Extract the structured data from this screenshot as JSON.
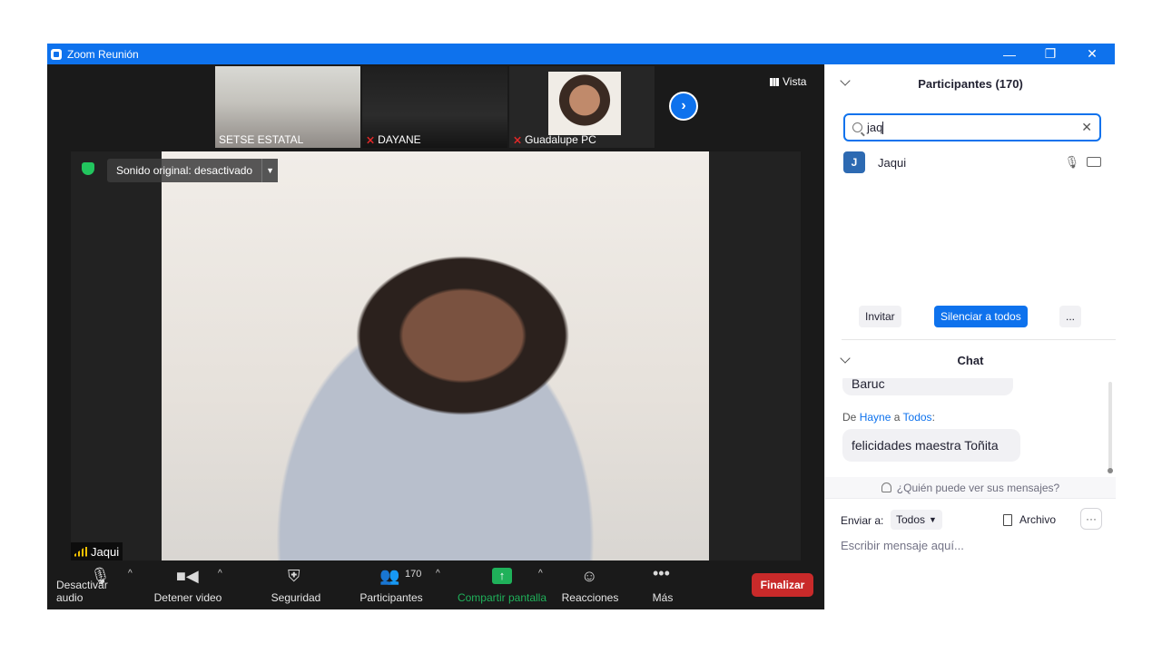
{
  "window": {
    "title": "Zoom Reunión",
    "controls": {
      "minimize": "—",
      "restore": "❐",
      "close": "✕"
    }
  },
  "thumbnails": [
    {
      "name": "SETSE ESTATAL",
      "muted": false
    },
    {
      "name": "DAYANE",
      "muted": true
    },
    {
      "name": "Guadalupe PC",
      "muted": true
    }
  ],
  "view_label": "Vista",
  "main_video": {
    "sound_status": "Sonido original: desactivado",
    "speaker_name": "Jaqui"
  },
  "toolbar": {
    "audio_label": "Desactivar audio",
    "video_label": "Detener video",
    "security_label": "Seguridad",
    "participants_label": "Participantes",
    "participants_count": "170",
    "share_label": "Compartir pantalla",
    "reactions_label": "Reacciones",
    "more_label": "Más",
    "end_label": "Finalizar"
  },
  "participants_panel": {
    "title": "Participantes (170)",
    "search_value": "jaq",
    "results": [
      {
        "initial": "J",
        "name": "Jaqui"
      }
    ],
    "invite_label": "Invitar",
    "mute_all_label": "Silenciar a todos",
    "more_label": "..."
  },
  "chat_panel": {
    "title": "Chat",
    "prev_message": "Baruc",
    "from_prefix": "De",
    "from_name": "Hayne",
    "to_word": "a",
    "to_name": "Todos",
    "colon": ":",
    "message": "felicidades maestra Toñita",
    "who_sees": "¿Quién puede ver sus mensajes?",
    "send_to_label": "Enviar a:",
    "send_to_value": "Todos",
    "file_label": "Archivo",
    "more_label": "···",
    "input_placeholder": "Escribir mensaje aquí..."
  },
  "colors": {
    "accent": "#0e72ed",
    "end_button": "#c92a2a",
    "share_green": "#1fb15a",
    "muted_red": "#e02828"
  }
}
